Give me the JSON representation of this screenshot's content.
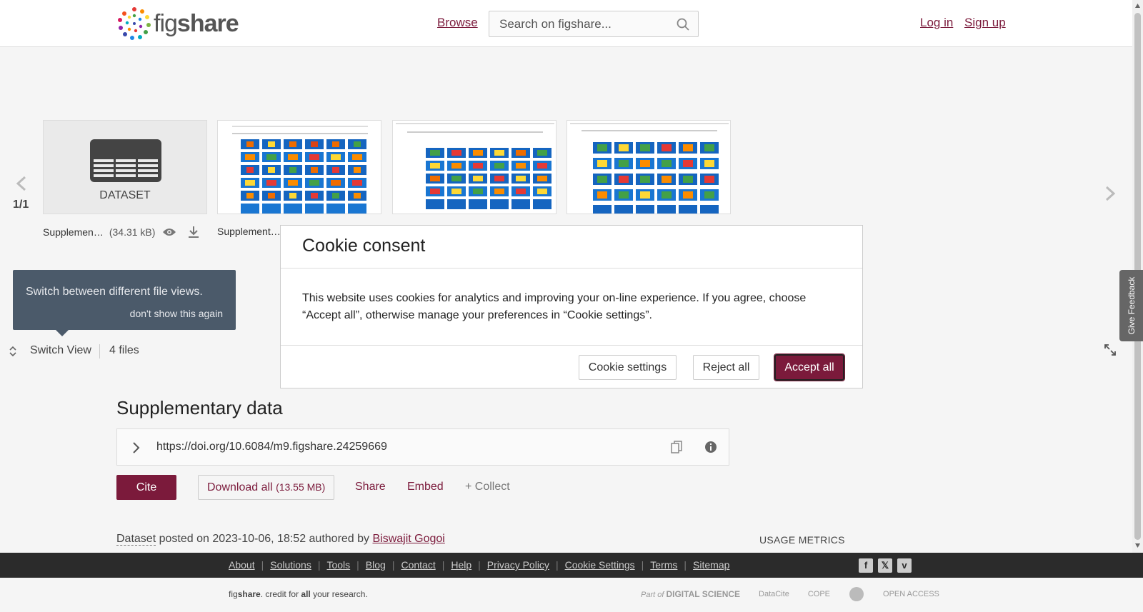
{
  "header": {
    "logo_prefix": "fig",
    "logo_suffix": "share",
    "browse_label": "Browse",
    "search_placeholder": "Search on figshare...",
    "login_label": "Log in",
    "signup_label": "Sign up"
  },
  "carousel": {
    "pager": "1/1",
    "dataset_label": "DATASET",
    "items": [
      {
        "name": "Supplemen…",
        "size": "(34.31 kB)"
      },
      {
        "name": "Supplement…"
      }
    ]
  },
  "tooltip": {
    "message": "Switch between different file views.",
    "dismiss": "don't show this again"
  },
  "view_bar": {
    "switch_label": "Switch View",
    "files_count": "4 files"
  },
  "item": {
    "title": "Supplementary data",
    "doi": "https://doi.org/10.6084/m9.figshare.24259669",
    "cite_label": "Cite",
    "download_label": "Download all",
    "download_size": "(13.55 MB)",
    "share_label": "Share",
    "embed_label": "Embed",
    "collect_label": "+ Collect",
    "type": "Dataset",
    "posted_text": " posted on 2023-10-06, 18:52 authored by ",
    "author": "Biswajit Gogoi",
    "usage_label": "USAGE METRICS"
  },
  "feedback_label": "Give Feedback",
  "footer": {
    "links": [
      "About",
      "Solutions",
      "Tools",
      "Blog",
      "Contact",
      "Help",
      "Privacy Policy",
      "Cookie Settings",
      "Terms",
      "Sitemap"
    ],
    "tagline_prefix": "fig",
    "tagline_brand": "share",
    "tagline_mid": ". credit for ",
    "tagline_all": "all",
    "tagline_end": " your research.",
    "partner_prefix": "Part of",
    "partner_ds": "DIGITAL SCIENCE",
    "partner_datacite": "DataCite",
    "partner_cope": "COPE",
    "partner_oa": "OPEN ACCESS"
  },
  "cookie": {
    "title": "Cookie consent",
    "body": "This website uses cookies for analytics and improving your on-line experience. If you agree, choose “Accept all”, otherwise manage your preferences in “Cookie settings”.",
    "settings_label": "Cookie settings",
    "reject_label": "Reject all",
    "accept_label": "Accept all"
  },
  "colors": {
    "brand": "#7b1a3b",
    "footer_dark": "#2b2b2b",
    "tooltip_bg": "#4b5a6a"
  }
}
